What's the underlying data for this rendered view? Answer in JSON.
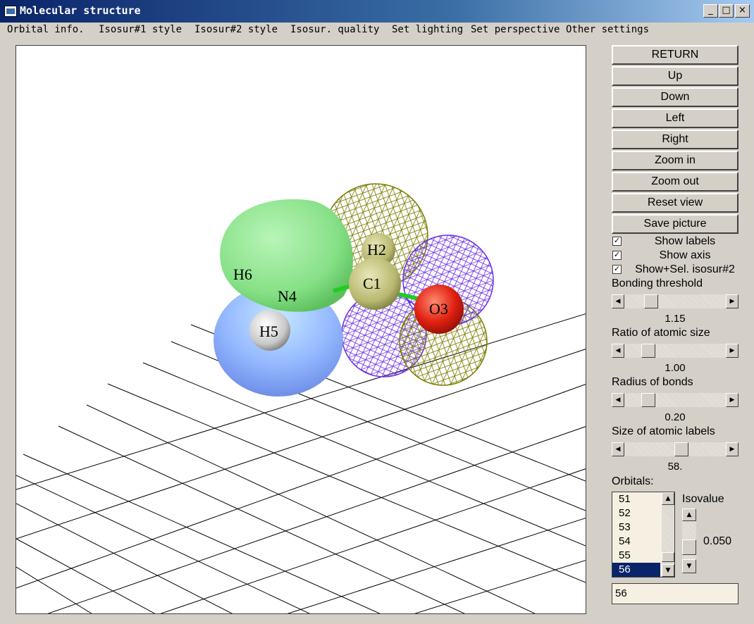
{
  "window": {
    "title": "Molecular structure",
    "controls": [
      "_",
      "□",
      "×"
    ]
  },
  "menu": [
    "Orbital info.",
    "Isosur#1 style",
    "Isosur#2 style",
    "Isosur. quality",
    "Set lighting",
    "Set perspective",
    "Other settings"
  ],
  "buttons": {
    "return": "RETURN",
    "up": "Up",
    "down": "Down",
    "left": "Left",
    "right": "Right",
    "zoom_in": "Zoom in",
    "zoom_out": "Zoom out",
    "reset": "Reset view",
    "save": "Save picture"
  },
  "checkboxes": [
    {
      "label": "Show labels",
      "checked": true,
      "mark": "✓"
    },
    {
      "label": "Show axis",
      "checked": true,
      "mark": "✓"
    },
    {
      "label": "Show+Sel. isosur#2",
      "checked": true,
      "mark": "✓"
    }
  ],
  "sliders": [
    {
      "label": "Bonding threshold",
      "value": "1.15",
      "position": 0.22
    },
    {
      "label": "Ratio of atomic size",
      "value": "1.00",
      "position": 0.19
    },
    {
      "label": "Radius of bonds",
      "value": "0.20",
      "position": 0.19
    },
    {
      "label": "Size of atomic labels",
      "value": "58.",
      "position": 0.68
    }
  ],
  "orbitals": {
    "label": "Orbitals:",
    "items": [
      "51",
      "52",
      "53",
      "54",
      "55",
      "56"
    ],
    "selected": "56",
    "isovalue_label": "Isovalue",
    "isovalue": "0.050",
    "field_value": "56"
  },
  "molecule": {
    "atoms": [
      "H6",
      "N4",
      "H5",
      "H2",
      "C1",
      "O3"
    ]
  },
  "colors": {
    "mesh_olive": "#7a7a00",
    "mesh_violet": "#6a2ee8",
    "lobe_green": "#8ee68e",
    "lobe_blue": "#8fb3ff",
    "oxygen": "#e02010",
    "selection": "#0a246a"
  },
  "icons": {
    "app": "window-app-icon",
    "left_arrow": "◀",
    "right_arrow": "▶",
    "up_arrow": "▲",
    "down_arrow": "▼"
  }
}
